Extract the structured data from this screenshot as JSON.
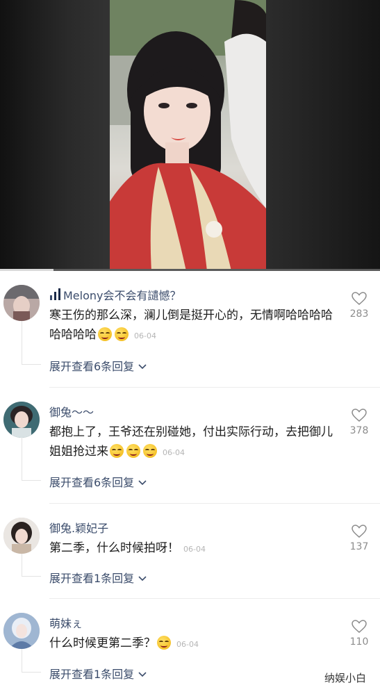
{
  "video": {
    "progress_fraction": 0.14
  },
  "comments": [
    {
      "username": "Melony会不会有讉憾？",
      "text": "寒王伤的那么深，澜儿倒是挺开心的，无情啊哈哈哈哈哈哈哈哈",
      "emoji_count": 2,
      "date": "06-04",
      "replies_label": "展开查看6条回复",
      "likes": "283"
    },
    {
      "username": "御兔～～",
      "text": "都抱上了，王爷还在别碰她，付出实际行动，去把御儿姐姐抢过来",
      "emoji_count": 3,
      "date": "06-04",
      "replies_label": "展开查看6条回复",
      "likes": "378"
    },
    {
      "username": "御兔.颖妃子",
      "text": "第二季，什么时候拍呀！",
      "emoji_count": 0,
      "date": "06-04",
      "replies_label": "展开查看1条回复",
      "likes": "137"
    },
    {
      "username": "萌妹ぇ",
      "text": "什么时候更第二季？",
      "emoji_count": 1,
      "date": "06-04",
      "replies_label": "展开查看1条回复",
      "likes": "110"
    }
  ],
  "watermark": "纳娱小白",
  "colors": {
    "username": "#3b4c6b",
    "text": "#1c1c1c",
    "muted": "#8c8c8c"
  },
  "icons": {
    "signal": "signal-bars-icon",
    "heart": "heart-outline-icon",
    "chevron": "chevron-down-icon",
    "emoji": "smirk-emoji-icon"
  }
}
